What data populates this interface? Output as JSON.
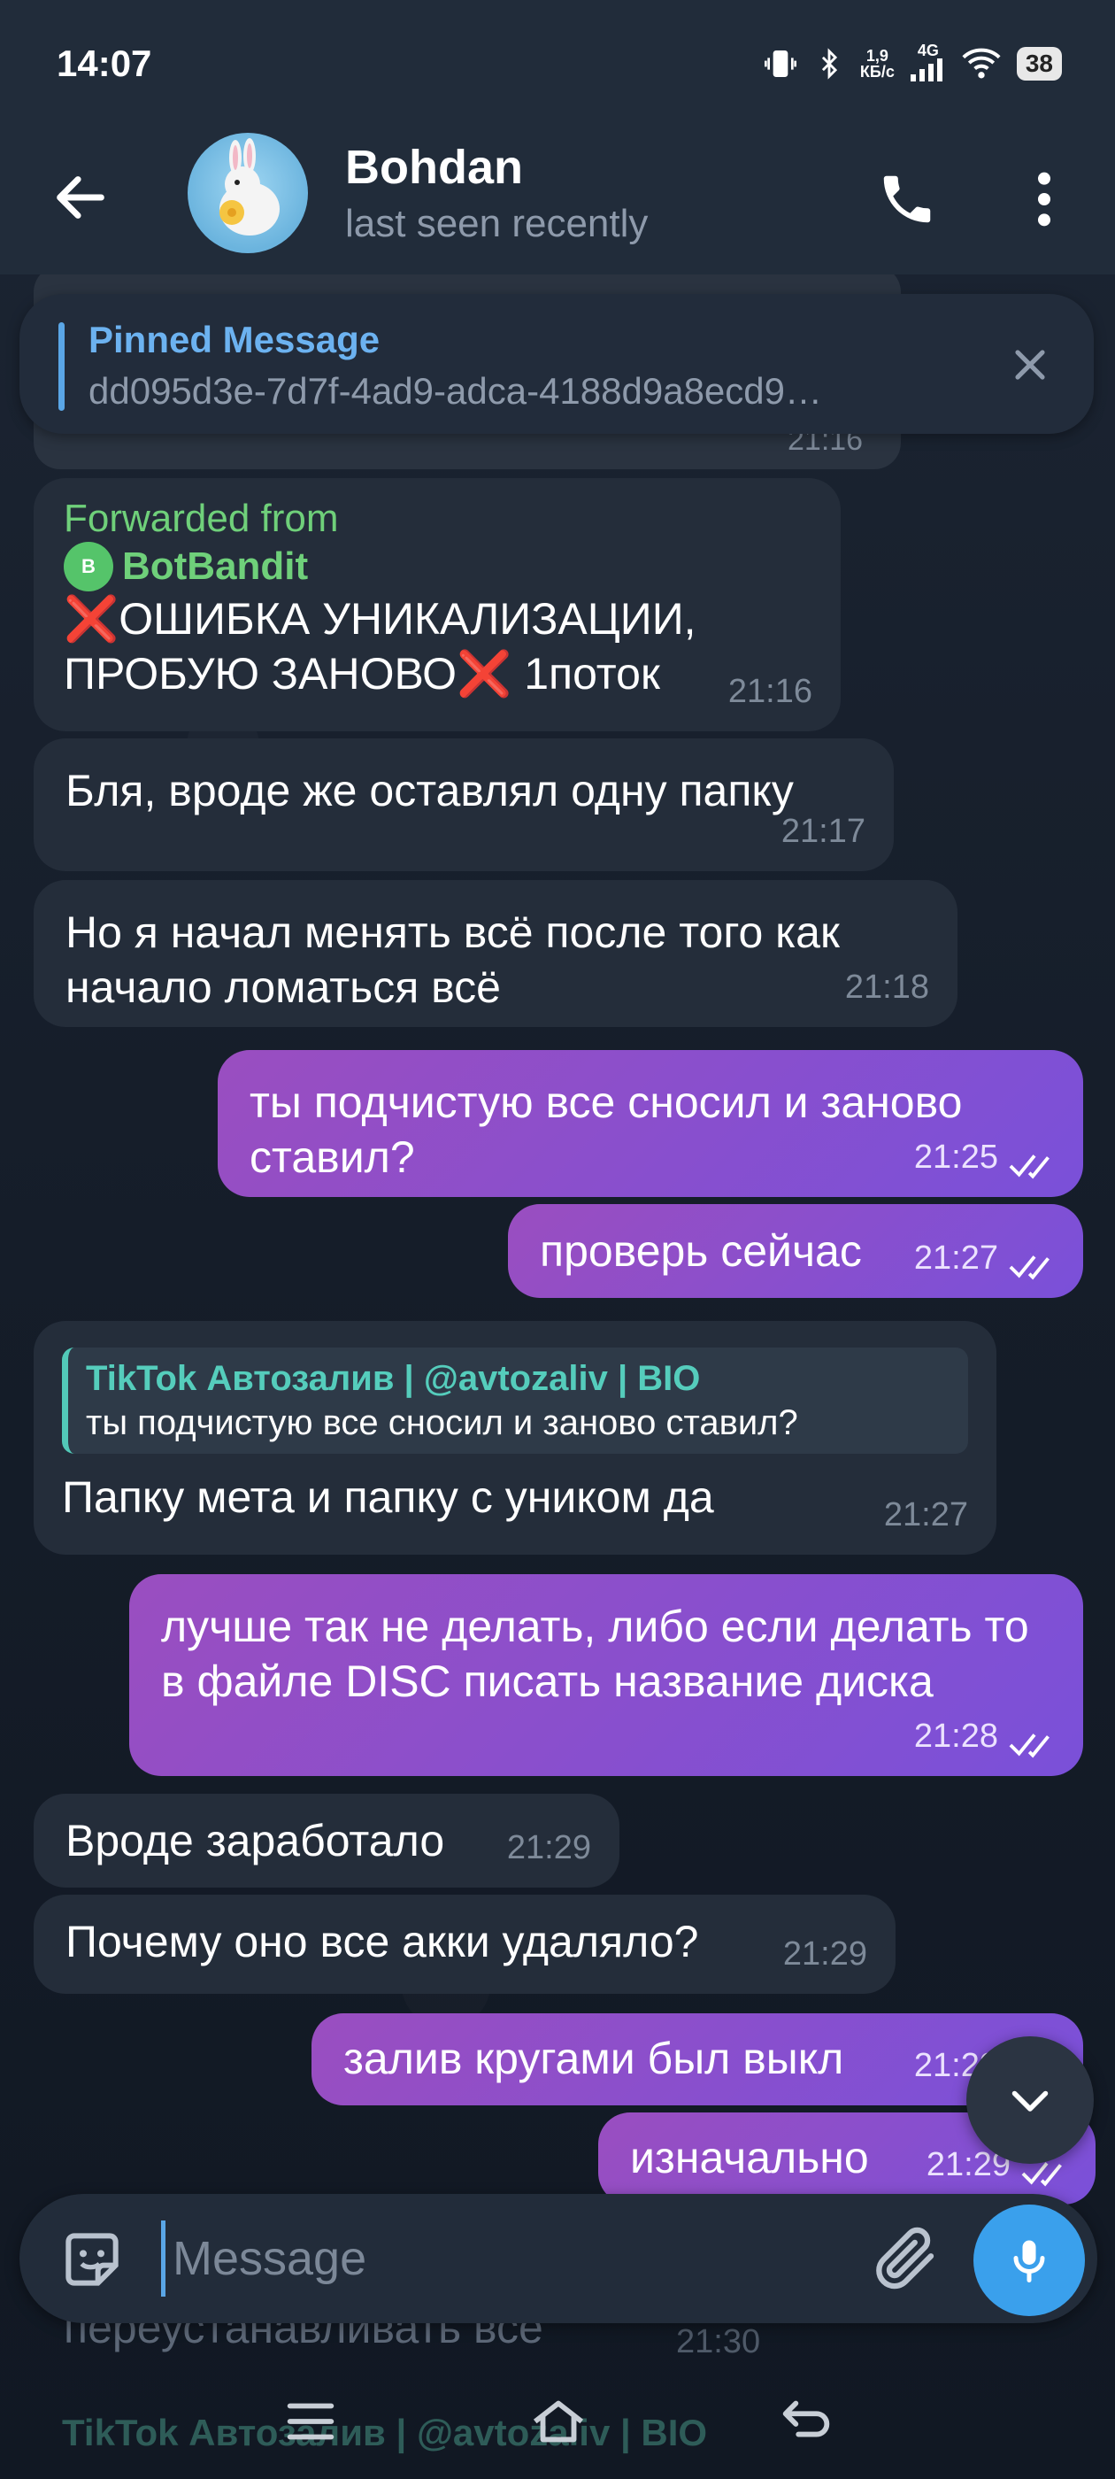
{
  "status_bar": {
    "time": "14:07",
    "speed_value": "1,9",
    "speed_unit": "КБ/с",
    "network": "4G",
    "battery": "38"
  },
  "header": {
    "contact_name": "Bohdan",
    "contact_status": "last seen recently"
  },
  "pinned": {
    "title": "Pinned Message",
    "text": "dd095d3e-7d7f-4ad9-adca-4188d9a8ecd9…"
  },
  "previous_message_time": "21:16",
  "messages": [
    {
      "type": "incoming",
      "forwarded_label": "Forwarded from",
      "forwarded_name": "BotBandit",
      "forwarded_avatar": "B",
      "cross1": "❌",
      "line1": "ОШИБКА УНИКАЛИЗАЦИИ,",
      "line2": "ПРОБУЮ ЗАНОВО",
      "cross2": "❌",
      "line2b": " 1поток",
      "time": "21:16"
    },
    {
      "type": "incoming",
      "text": "Бля, вроде же оставлял одну папку",
      "time": "21:17"
    },
    {
      "type": "incoming",
      "text": "Но я начал менять всё после того как начало ломаться всё",
      "time": "21:18"
    },
    {
      "type": "outgoing",
      "text": "ты подчистую все сносил и заново ставил?",
      "time": "21:25"
    },
    {
      "type": "outgoing",
      "text": "проверь сейчас",
      "time": "21:27"
    },
    {
      "type": "incoming",
      "reply_title": "TikTok Автозалив | @avtozaliv | BIO",
      "reply_text": "ты подчистую все сносил и заново ставил?",
      "text": "Папку мета и папку с уником да",
      "time": "21:27"
    },
    {
      "type": "outgoing",
      "text": "лучше так не делать, либо если делать то в файле DISC писать название диска",
      "time": "21:28"
    },
    {
      "type": "incoming",
      "text": "Вроде заработало",
      "time": "21:29"
    },
    {
      "type": "incoming",
      "text": "Почему оно все акки удаляло?",
      "time": "21:29"
    },
    {
      "type": "outgoing",
      "text": "залив кругами был выкл",
      "time": "21:29"
    },
    {
      "type": "outgoing",
      "text": "изначально",
      "time": "21:29"
    }
  ],
  "input": {
    "placeholder": "Message"
  },
  "below_input": {
    "text": "переустанавливать все",
    "time": "21:30",
    "reply_title": "TikTok Автозалив | @avtozaliv | BIO"
  },
  "colors": {
    "outgoing_start": "#9a4ec0",
    "outgoing_end": "#7a50d9",
    "incoming": "#242d3a",
    "accent": "#3aa0ec",
    "forward_green": "#6fd07a",
    "reply_teal": "#55cdbc"
  },
  "icons": [
    "back-arrow-icon",
    "phone-icon",
    "more-vertical-icon",
    "close-icon",
    "double-check-icon",
    "chevron-down-icon",
    "sticker-icon",
    "paperclip-icon",
    "microphone-icon"
  ]
}
